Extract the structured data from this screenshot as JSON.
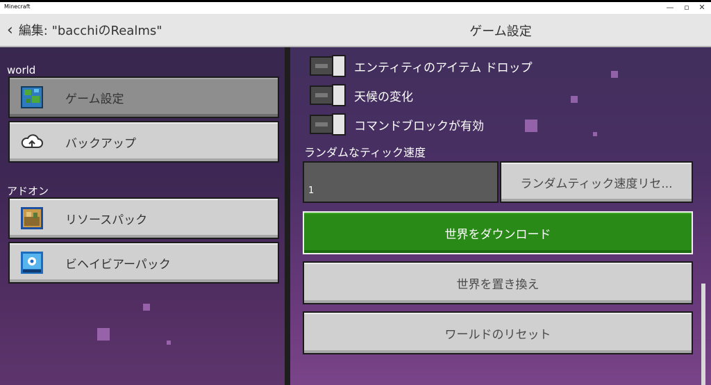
{
  "window": {
    "title": "Minecraft",
    "controls": [
      "—",
      "▫",
      "✕"
    ]
  },
  "header": {
    "back_label": "編集: \"bacchiのRealms\"",
    "title": "ゲーム設定"
  },
  "sidebar": {
    "sections": [
      {
        "label": "world",
        "items": [
          {
            "label": "ゲーム設定",
            "icon": "globe-icon",
            "selected": true
          },
          {
            "label": "バックアップ",
            "icon": "cloud-upload-icon",
            "selected": false
          }
        ]
      },
      {
        "label": "アドオン",
        "items": [
          {
            "label": "リソースパック",
            "icon": "resource-pack-icon",
            "selected": false
          },
          {
            "label": "ビヘイビアーパック",
            "icon": "behavior-pack-icon",
            "selected": false
          }
        ]
      }
    ]
  },
  "settings": {
    "toggles": [
      {
        "label": "エンティティのアイテム ドロップ",
        "on": true
      },
      {
        "label": "天候の変化",
        "on": true
      },
      {
        "label": "コマンドブロックが有効",
        "on": true
      }
    ],
    "random_tick": {
      "label": "ランダムなティック速度",
      "value": "1",
      "reset_label": "ランダムティック速度リセ..."
    },
    "buttons": {
      "download": "世界をダウンロード",
      "replace": "世界を置き換え",
      "reset_world": "ワールドのリセット"
    }
  },
  "colors": {
    "accent_green": "#2a8a18",
    "background_purple": "#4a2f64"
  }
}
